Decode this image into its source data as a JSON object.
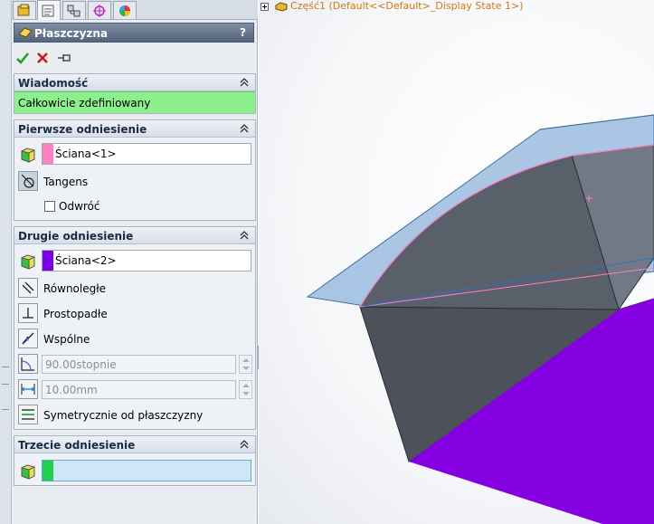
{
  "panel": {
    "title": "Płaszczyzna",
    "help": "?",
    "tabs": [
      "feature-manager-icon",
      "property-manager-icon",
      "configuration-manager-icon",
      "dimxpert-icon",
      "display-manager-icon"
    ]
  },
  "groups": {
    "message": {
      "title": "Wiadomość",
      "text": "Całkowicie zdefiniowany",
      "color": "#8cf08c"
    },
    "first_ref": {
      "title": "Pierwsze odniesienie",
      "selection": "Ściana<1>",
      "swatch": "#ff80c0",
      "tangent_label": "Tangens",
      "flip_label": "Odwróć"
    },
    "second_ref": {
      "title": "Drugie odniesienie",
      "selection": "Ściana<2>",
      "swatch": "#7a00e6",
      "parallel_label": "Równoległe",
      "perpendicular_label": "Prostopadłe",
      "coincident_label": "Wspólne",
      "angle_value": "90.00stopnie",
      "distance_value": "10.00mm",
      "midplane_label": "Symetrycznie od płaszczyzny"
    },
    "third_ref": {
      "title": "Trzecie odniesienie",
      "swatch": "#1ed04a",
      "selection": ""
    }
  },
  "graphics": {
    "tree_label": "Część1  (Default<<Default>_Display State 1>)",
    "plane_color": "#8fb4dc",
    "face_top_color": "#707886",
    "face_front_color": "#4c515a",
    "face_bottom_color": "#8400e0"
  }
}
